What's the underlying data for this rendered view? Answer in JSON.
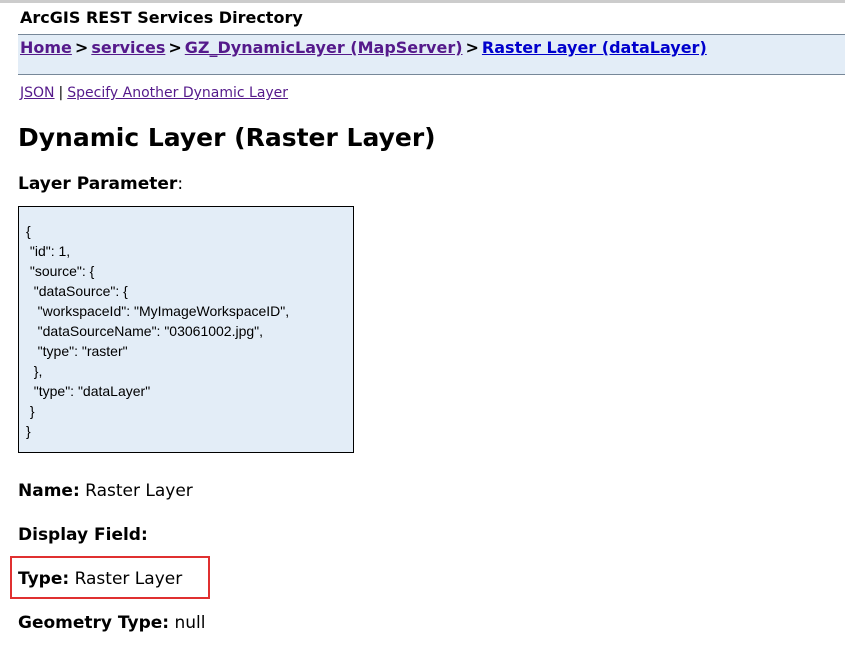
{
  "header": {
    "title": "ArcGIS REST Services Directory"
  },
  "breadcrumb": {
    "home": "Home",
    "services": "services",
    "mapserver": "GZ_DynamicLayer (MapServer)",
    "current": "Raster Layer (dataLayer)",
    "separator": ">"
  },
  "sublinks": {
    "json": "JSON",
    "pipe": "|",
    "specify": "Specify Another Dynamic Layer"
  },
  "page": {
    "title": "Dynamic Layer (Raster Layer)",
    "layer_param_label": "Layer Parameter",
    "layer_param_colon": ":"
  },
  "layer_parameter_json": "{\n \"id\": 1,\n \"source\": {\n  \"dataSource\": {\n   \"workspaceId\": \"MyImageWorkspaceID\",\n   \"dataSourceName\": \"03061002.jpg\",\n   \"type\": \"raster\"\n  },\n  \"type\": \"dataLayer\"\n }\n}",
  "fields": {
    "name_label": "Name:",
    "name_value": "Raster Layer",
    "display_field_label": "Display Field:",
    "display_field_value": "",
    "type_label": "Type:",
    "type_value": "Raster Layer",
    "geometry_type_label": "Geometry Type:",
    "geometry_type_value": "null"
  },
  "colors": {
    "bar_background": "#e3edf7",
    "visited_link": "#551a8b",
    "active_link": "#0000cc",
    "highlight": "#e03030"
  }
}
